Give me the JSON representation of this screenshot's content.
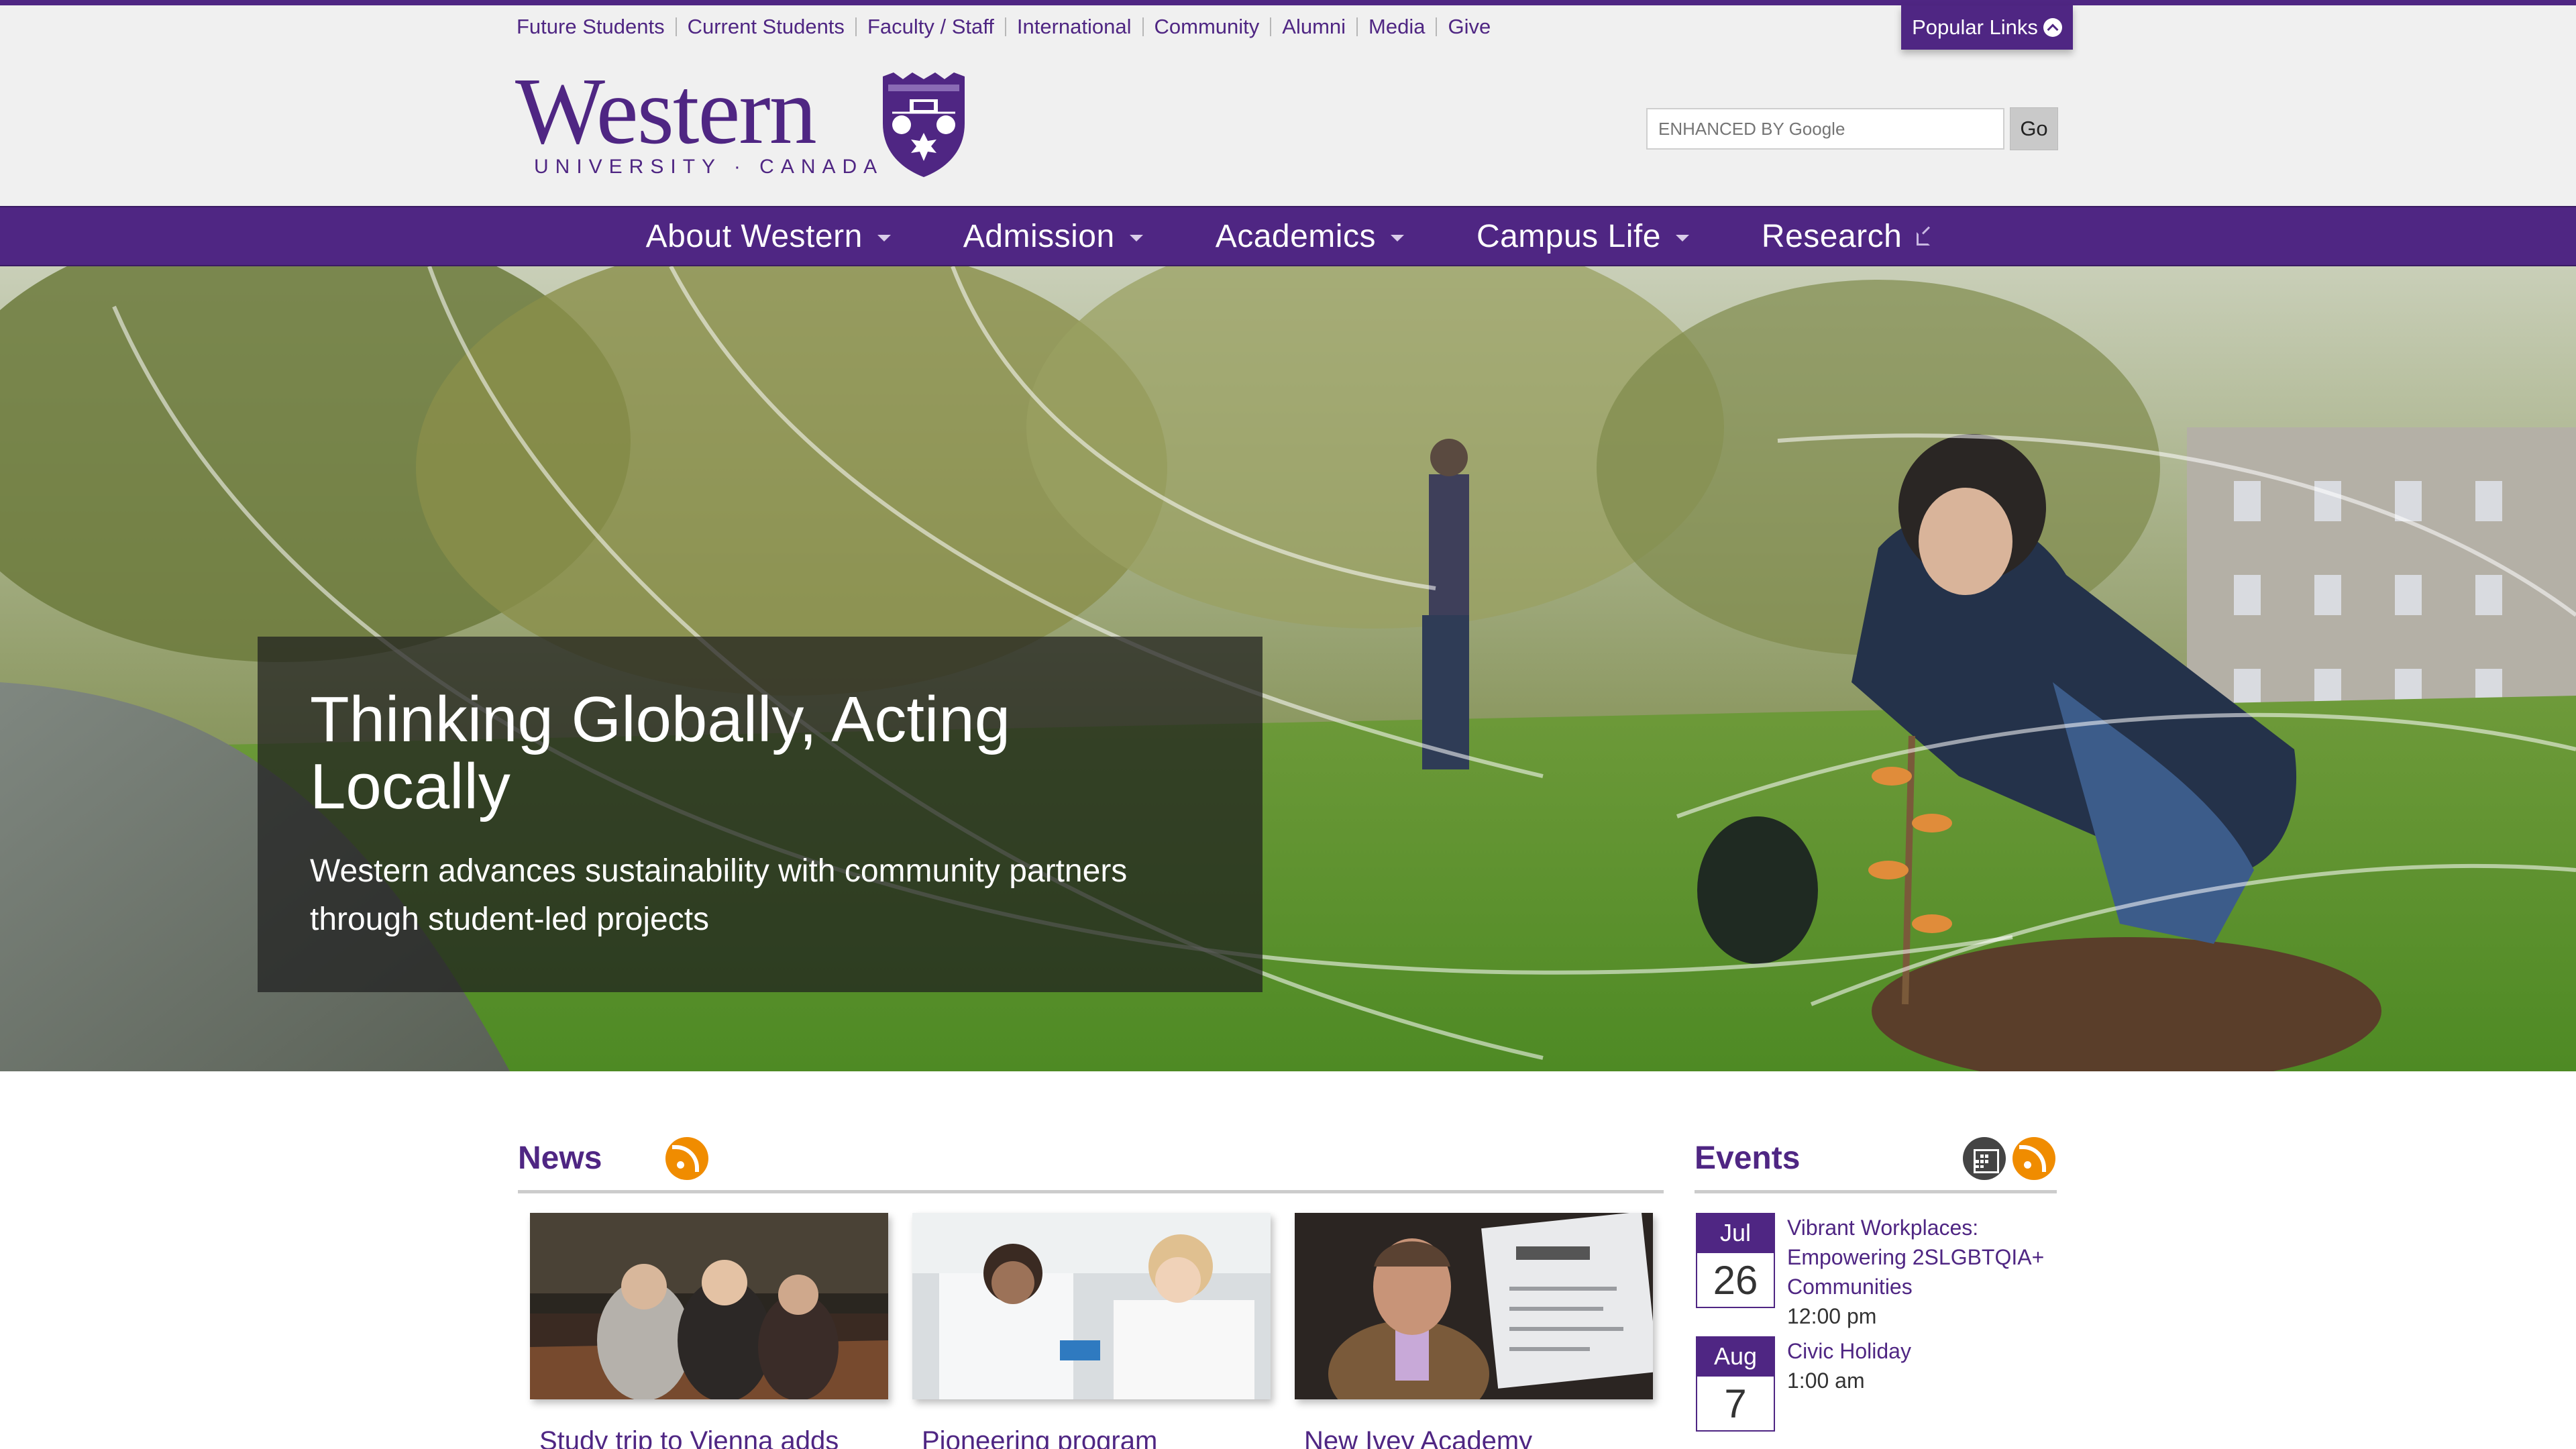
{
  "utility_links": [
    "Future Students",
    "Current Students",
    "Faculty / Staff",
    "International",
    "Community",
    "Alumni",
    "Media",
    "Give"
  ],
  "popular_links": "Popular Links",
  "logo": {
    "wordmark": "Western",
    "subtitle": "UNIVERSITY · CANADA"
  },
  "search": {
    "placeholder": "ENHANCED BY Google",
    "go_label": "Go"
  },
  "nav": [
    {
      "label": "About Western",
      "icon": "caret-down"
    },
    {
      "label": "Admission",
      "icon": "caret-down"
    },
    {
      "label": "Academics",
      "icon": "caret-down"
    },
    {
      "label": "Campus Life",
      "icon": "caret-down"
    },
    {
      "label": "Research",
      "icon": "external-link"
    }
  ],
  "hero": {
    "title": "Thinking Globally, Acting Locally",
    "subtitle": "Western advances sustainability with community partners through student-led projects"
  },
  "news": {
    "title": "News",
    "items": [
      {
        "title": "Study trip to Vienna adds"
      },
      {
        "title": "Pioneering program"
      },
      {
        "title": "New Ivey Academy"
      }
    ]
  },
  "events": {
    "title": "Events",
    "items": [
      {
        "month": "Jul",
        "day": "26",
        "title": "Vibrant Workplaces: Empowering 2SLGBTQIA+ Communities",
        "time": "12:00 pm"
      },
      {
        "month": "Aug",
        "day": "7",
        "title": "Civic Holiday",
        "time": "1:00 am"
      }
    ]
  },
  "colors": {
    "brand_purple": "#4f2683",
    "rss_orange": "#f08c00",
    "search_button": "#c9c9c9"
  }
}
